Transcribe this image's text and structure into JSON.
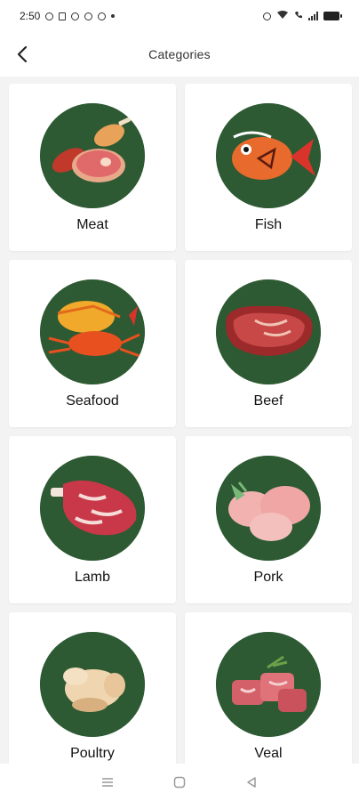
{
  "status_bar": {
    "time": "2:50"
  },
  "header": {
    "title": "Categories"
  },
  "categories": [
    {
      "label": "Meat"
    },
    {
      "label": "Fish"
    },
    {
      "label": "Seafood"
    },
    {
      "label": "Beef"
    },
    {
      "label": "Lamb"
    },
    {
      "label": "Pork"
    },
    {
      "label": "Poultry"
    },
    {
      "label": "Veal"
    }
  ],
  "colors": {
    "circle_bg": "#2d5a32",
    "card_bg": "#ffffff",
    "page_bg": "#f3f3f3"
  }
}
